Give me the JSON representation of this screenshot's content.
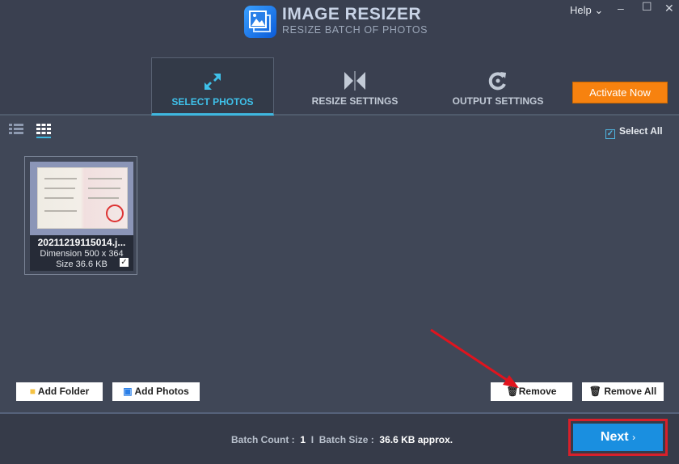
{
  "app": {
    "title": "IMAGE RESIZER",
    "subtitle": "RESIZE BATCH OF PHOTOS",
    "help": "Help",
    "activate": "Activate Now"
  },
  "tabs": [
    {
      "label": "SELECT PHOTOS",
      "icon": "expand-arrows-icon",
      "active": true
    },
    {
      "label": "RESIZE SETTINGS",
      "icon": "resize-icon"
    },
    {
      "label": "OUTPUT SETTINGS",
      "icon": "refresh-icon"
    }
  ],
  "toolbar": {
    "select_all": "Select All",
    "select_all_checked": true
  },
  "photos": [
    {
      "name": "20211219115014.j...",
      "dimension": "Dimension 500 x 364",
      "size": "Size 36.6 KB",
      "checked": true
    }
  ],
  "actions": {
    "add_folder": "Add Folder",
    "add_photos": "Add Photos",
    "remove": "Remove",
    "remove_all": "Remove All"
  },
  "footer": {
    "batch_count_label": "Batch Count :",
    "batch_count": "1",
    "divider": "I",
    "batch_size_label": "Batch Size :",
    "batch_size": "36.6 KB approx.",
    "next": "Next"
  },
  "colors": {
    "accent": "#3fc1ea",
    "activate": "#f7820f",
    "next": "#1a8fe0",
    "annotation": "#d8202a"
  }
}
